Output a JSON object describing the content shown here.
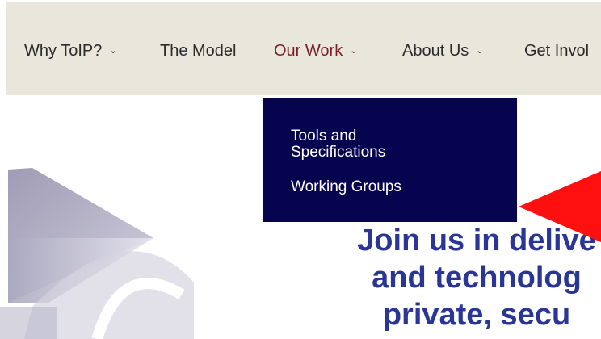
{
  "nav": {
    "items": [
      {
        "label": "Why ToIP?",
        "has_chevron": true
      },
      {
        "label": "The Model",
        "has_chevron": false
      },
      {
        "label": "Our Work",
        "has_chevron": true,
        "active": true
      },
      {
        "label": "About Us",
        "has_chevron": true
      },
      {
        "label": "Get Invol",
        "has_chevron": false
      }
    ],
    "chevron_glyph": "⌄"
  },
  "dropdown": {
    "items": [
      {
        "label_line1": "Tools and",
        "label_line2": "Specifications"
      },
      {
        "label": "Working Groups"
      }
    ]
  },
  "hero": {
    "line1": "Join us in delive",
    "line2": "and technolog",
    "line3": "private, secu"
  },
  "colors": {
    "nav_background": "#e9e6dc",
    "nav_text": "#2b2b2b",
    "nav_active": "#7a1f2b",
    "dropdown_background": "#06044f",
    "hero_text": "#2a3695",
    "annotation_arrow": "#ff0000"
  }
}
